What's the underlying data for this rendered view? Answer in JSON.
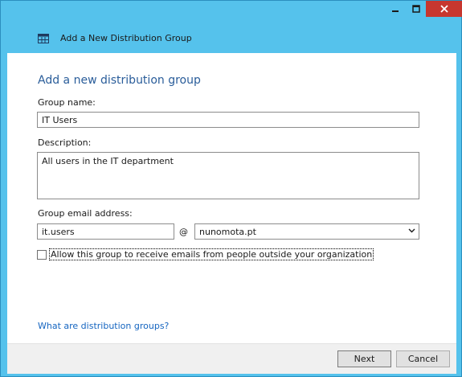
{
  "window": {
    "title": "Add a New Distribution Group",
    "controls": {
      "minimize": "minimize-icon",
      "maximize": "maximize-icon",
      "close": "close-icon"
    },
    "accent_color": "#55c2ec",
    "close_color": "#c7372f"
  },
  "form": {
    "heading": "Add a new distribution group",
    "group_name_label": "Group name:",
    "group_name_value": "IT Users",
    "description_label": "Description:",
    "description_value": "All users in the IT department",
    "email_label": "Group email address:",
    "email_local_value": "it.users",
    "at_symbol": "@",
    "domain_value": "nunomota.pt",
    "allow_external_label": "Allow this group to receive emails from people outside your organization",
    "allow_external_checked": false,
    "help_link": "What are distribution groups?"
  },
  "footer": {
    "next_label": "Next",
    "cancel_label": "Cancel"
  }
}
